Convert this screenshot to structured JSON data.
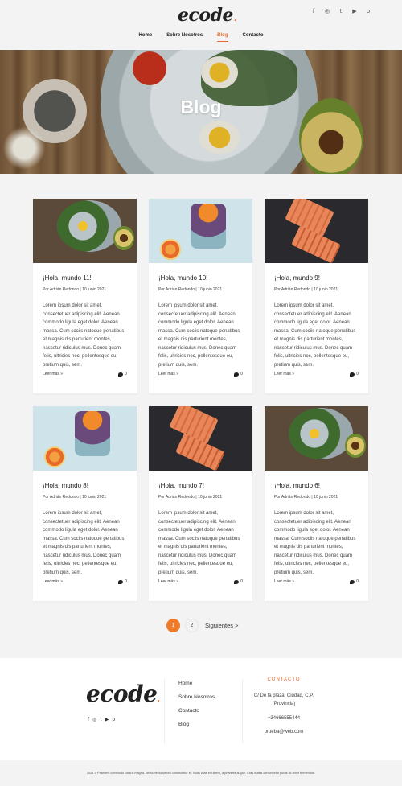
{
  "brand": {
    "logo": "ecode",
    "logo_dot": "."
  },
  "social_icons": [
    "facebook-icon",
    "instagram-icon",
    "twitter-icon",
    "youtube-icon",
    "pinterest-icon"
  ],
  "social_glyphs": {
    "facebook": "f",
    "instagram": "◎",
    "twitter": "t",
    "youtube": "▶",
    "pinterest": "p"
  },
  "nav": {
    "items": [
      {
        "label": "Home"
      },
      {
        "label": "Sobre Nosotros"
      },
      {
        "label": "Blog",
        "active": true
      },
      {
        "label": "Contacto"
      }
    ]
  },
  "hero": {
    "title": "Blog"
  },
  "posts": [
    {
      "title": "¡Hola, mundo 11!",
      "meta": "Por Adrián Redondo | 10 junio 2021",
      "excerpt": "Lorem ipsum dolor sit amet, consectetuer adipiscing elit. Aenean commodo ligula eget dolor. Aenean massa. Cum sociis natoque penatibus et magnis dis parturient montes, nascetur ridiculus mus. Donec quam felis, ultricies nec, pellentesque eu, pretium quis, sem.",
      "read_more": "Leer más »",
      "comments": "0",
      "image": "salad"
    },
    {
      "title": "¡Hola, mundo 10!",
      "meta": "Por Adrián Redondo | 10 junio 2021",
      "excerpt": "Lorem ipsum dolor sit amet, consectetuer adipiscing elit. Aenean commodo ligula eget dolor. Aenean massa. Cum sociis natoque penatibus et magnis dis parturient montes, nascetur ridiculus mus. Donec quam felis, ultricies nec, pellentesque eu, pretium quis, sem.",
      "read_more": "Leer más »",
      "comments": "0",
      "image": "jar"
    },
    {
      "title": "¡Hola, mundo 9!",
      "meta": "Por Adrián Redondo | 10 junio 2021",
      "excerpt": "Lorem ipsum dolor sit amet, consectetuer adipiscing elit. Aenean commodo ligula eget dolor. Aenean massa. Cum sociis natoque penatibus et magnis dis parturient montes, nascetur ridiculus mus. Donec quam felis, ultricies nec, pellentesque eu, pretium quis, sem.",
      "read_more": "Leer más »",
      "comments": "0",
      "image": "board"
    },
    {
      "title": "¡Hola, mundo 8!",
      "meta": "Por Adrián Redondo | 10 junio 2021",
      "excerpt": "Lorem ipsum dolor sit amet, consectetuer adipiscing elit. Aenean commodo ligula eget dolor. Aenean massa. Cum sociis natoque penatibus et magnis dis parturient montes, nascetur ridiculus mus. Donec quam felis, ultricies nec, pellentesque eu, pretium quis, sem.",
      "read_more": "Leer más »",
      "comments": "0",
      "image": "jar"
    },
    {
      "title": "¡Hola, mundo 7!",
      "meta": "Por Adrián Redondo | 10 junio 2021",
      "excerpt": "Lorem ipsum dolor sit amet, consectetuer adipiscing elit. Aenean commodo ligula eget dolor. Aenean massa. Cum sociis natoque penatibus et magnis dis parturient montes, nascetur ridiculus mus. Donec quam felis, ultricies nec, pellentesque eu, pretium quis, sem.",
      "read_more": "Leer más »",
      "comments": "0",
      "image": "board"
    },
    {
      "title": "¡Hola, mundo 6!",
      "meta": "Por Adrián Redondo | 10 junio 2021",
      "excerpt": "Lorem ipsum dolor sit amet, consectetuer adipiscing elit. Aenean commodo ligula eget dolor. Aenean massa. Cum sociis natoque penatibus et magnis dis parturient montes, nascetur ridiculus mus. Donec quam felis, ultricies nec, pellentesque eu, pretium quis, sem.",
      "read_more": "Leer más »",
      "comments": "0",
      "image": "salad"
    }
  ],
  "pagination": {
    "current": "1",
    "page2": "2",
    "next": "Siguientes >"
  },
  "footer": {
    "logo": "ecode",
    "logo_dot": ".",
    "links": [
      "Home",
      "Sobre Nosotros",
      "Contacto",
      "Blog"
    ],
    "contact_heading": "CONTACTO",
    "address": "C/ De la plaza, Ciudad, C.P. (Provincia)",
    "phone": "+34666555444",
    "email": "prueba@web.com",
    "copyright": "2021 © Praesent commodo cursus magna, vel scelerisque nisl consectetur et. Nulla vitae elit libero, a pharetra augue. Cras mattis consectetur purus sit amet fermentum."
  },
  "colors": {
    "accent": "#e86a2a",
    "pager_active": "#ee7b2c",
    "page_bg": "#f3f3f3"
  }
}
